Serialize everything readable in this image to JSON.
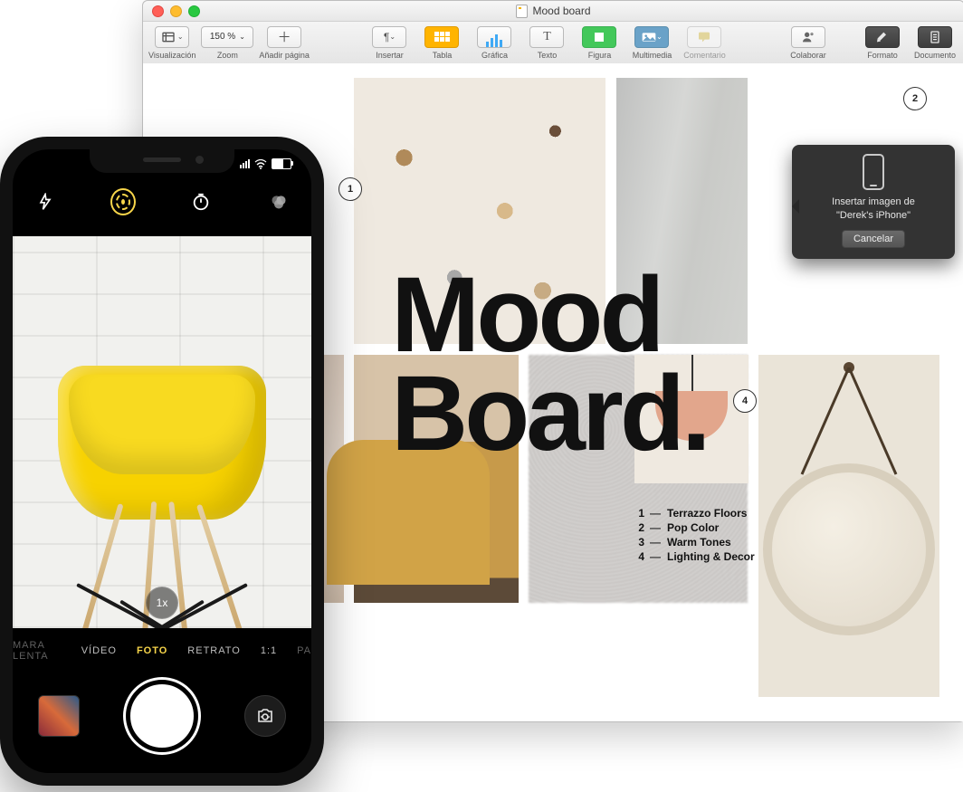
{
  "window": {
    "title": "Mood board",
    "traffic": [
      "close",
      "minimize",
      "zoom"
    ]
  },
  "toolbar": {
    "view": "Visualización",
    "zoom_label": "Zoom",
    "zoom_value": "150 %",
    "add_page": "Añadir página",
    "insert": "Insertar",
    "table": "Tabla",
    "chart": "Gráfica",
    "text": "Texto",
    "shape": "Figura",
    "media": "Multimedia",
    "comment": "Comentario",
    "collaborate": "Colaborar",
    "format": "Formato",
    "document": "Documento"
  },
  "document": {
    "title_line1": "Mood",
    "title_line2": "Board.",
    "badges": {
      "b1": "1",
      "b2": "2",
      "b4": "4"
    },
    "legend": {
      "items": [
        {
          "n": "1",
          "dash": "—",
          "label": "Terrazzo Floors"
        },
        {
          "n": "2",
          "dash": "—",
          "label": "Pop Color"
        },
        {
          "n": "3",
          "dash": "—",
          "label": "Warm Tones"
        },
        {
          "n": "4",
          "dash": "—",
          "label": "Lighting & Decor"
        }
      ]
    }
  },
  "popover": {
    "text_line1": "Insertar imagen de",
    "text_line2": "\"Derek's iPhone\"",
    "cancel": "Cancelar"
  },
  "iphone": {
    "camera": {
      "zoom_pill": "1x",
      "modes": {
        "slow": "MARA LENTA",
        "video": "VÍDEO",
        "photo": "FOTO",
        "portrait": "RETRATO",
        "square": "1:1",
        "pano": "PA"
      }
    }
  }
}
